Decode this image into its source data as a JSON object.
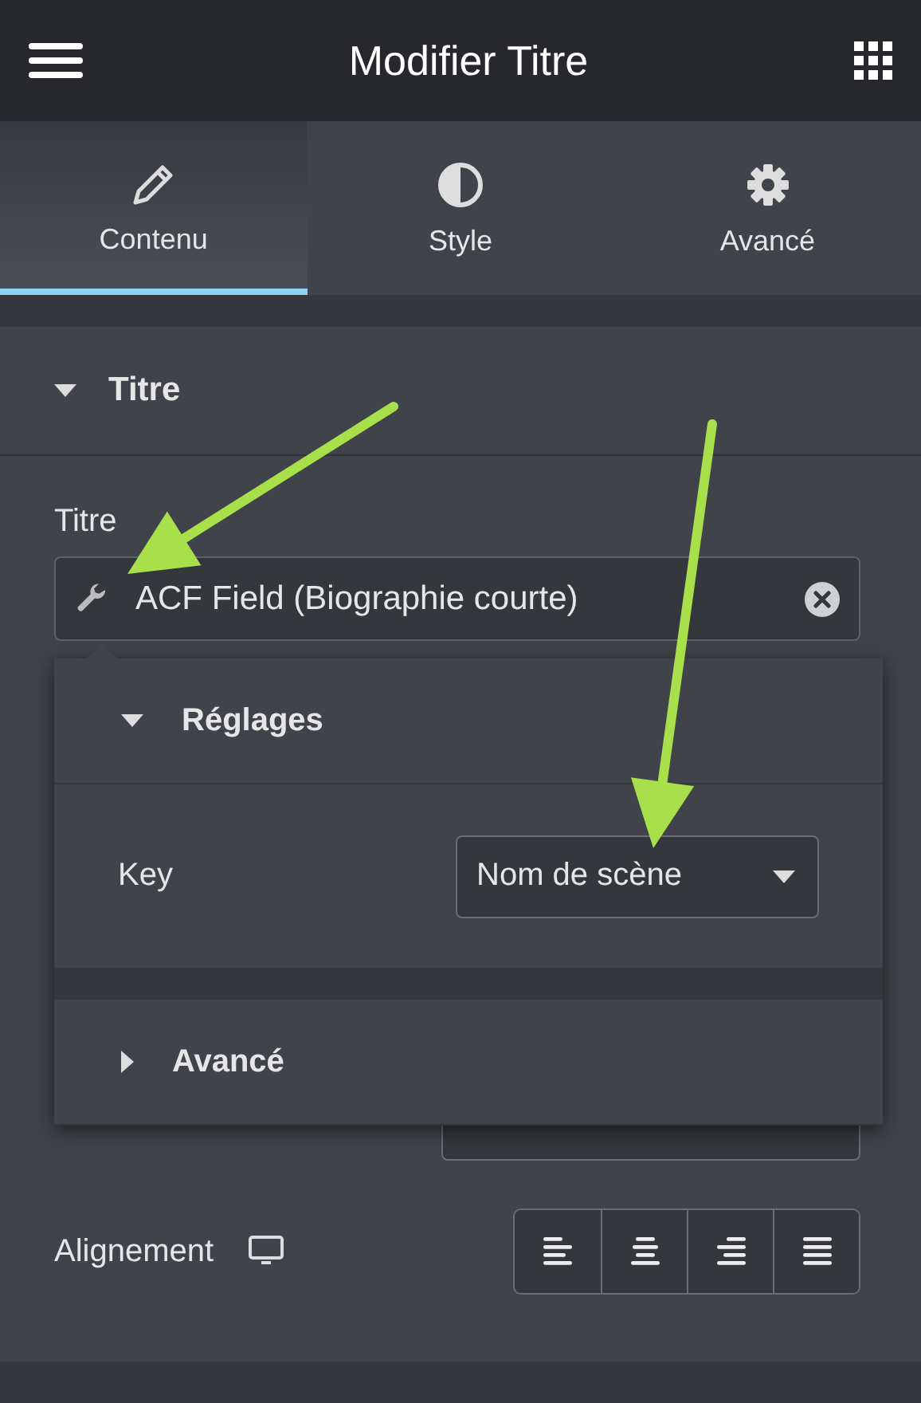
{
  "header": {
    "title": "Modifier Titre"
  },
  "tabs": [
    {
      "label": "Contenu",
      "selected": true
    },
    {
      "label": "Style",
      "selected": false
    },
    {
      "label": "Avancé",
      "selected": false
    }
  ],
  "section": {
    "title": "Titre",
    "expanded": true
  },
  "title_control": {
    "label": "Titre",
    "value": "ACF Field (Biographie courte)"
  },
  "dynamic_popup": {
    "groups": [
      {
        "title": "Réglages",
        "expanded": true,
        "fields": [
          {
            "label": "Key",
            "value": "Nom de scène"
          }
        ]
      },
      {
        "title": "Avancé",
        "expanded": false
      }
    ]
  },
  "alignment": {
    "label": "Alignement",
    "options": [
      {
        "kind": "left",
        "selected": false
      },
      {
        "kind": "center",
        "selected": false
      },
      {
        "kind": "right",
        "selected": false
      },
      {
        "kind": "justify",
        "selected": false
      }
    ]
  }
}
